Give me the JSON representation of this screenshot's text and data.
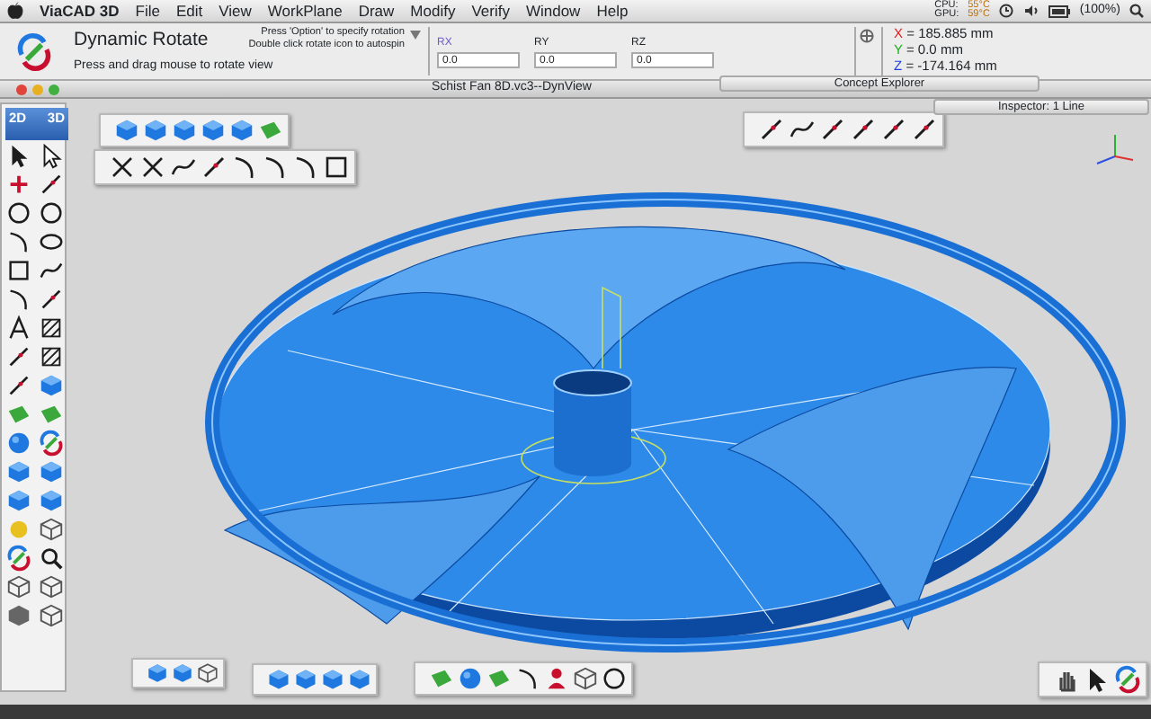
{
  "menu_bar": {
    "app": "ViaCAD 3D",
    "items": [
      "File",
      "Edit",
      "View",
      "WorkPlane",
      "Draw",
      "Modify",
      "Verify",
      "Window",
      "Help"
    ],
    "status": {
      "cpu_label": "CPU:",
      "gpu_label": "GPU:",
      "cpu_temp": "55°C",
      "gpu_temp": "59°C",
      "battery": "(100%)"
    }
  },
  "tool_header": {
    "title": "Dynamic Rotate",
    "hints": [
      "Press 'Option' to specify rotation",
      "Double click rotate icon to autospin"
    ],
    "prompt": "Press and drag mouse to rotate view",
    "fields": [
      {
        "label": "RX",
        "value": "0.0",
        "selected": true
      },
      {
        "label": "RY",
        "value": "0.0",
        "selected": false
      },
      {
        "label": "RZ",
        "value": "0.0",
        "selected": false
      }
    ]
  },
  "coordinates": [
    {
      "axis": "X",
      "value": "= 185.885 mm",
      "color": "#e02020"
    },
    {
      "axis": "Y",
      "value": "= 0.0 mm",
      "color": "#20b020"
    },
    {
      "axis": "Z",
      "value": "= -174.164 mm",
      "color": "#2040e0"
    }
  ],
  "concept_explorer": {
    "title": "Concept Explorer"
  },
  "document_window": {
    "title": "Schist Fan 8D.vc3--DynView"
  },
  "inspector": {
    "title": "Inspector:  1 Line"
  },
  "toolbox": {
    "mode_labels": [
      "2D",
      "3D"
    ]
  }
}
